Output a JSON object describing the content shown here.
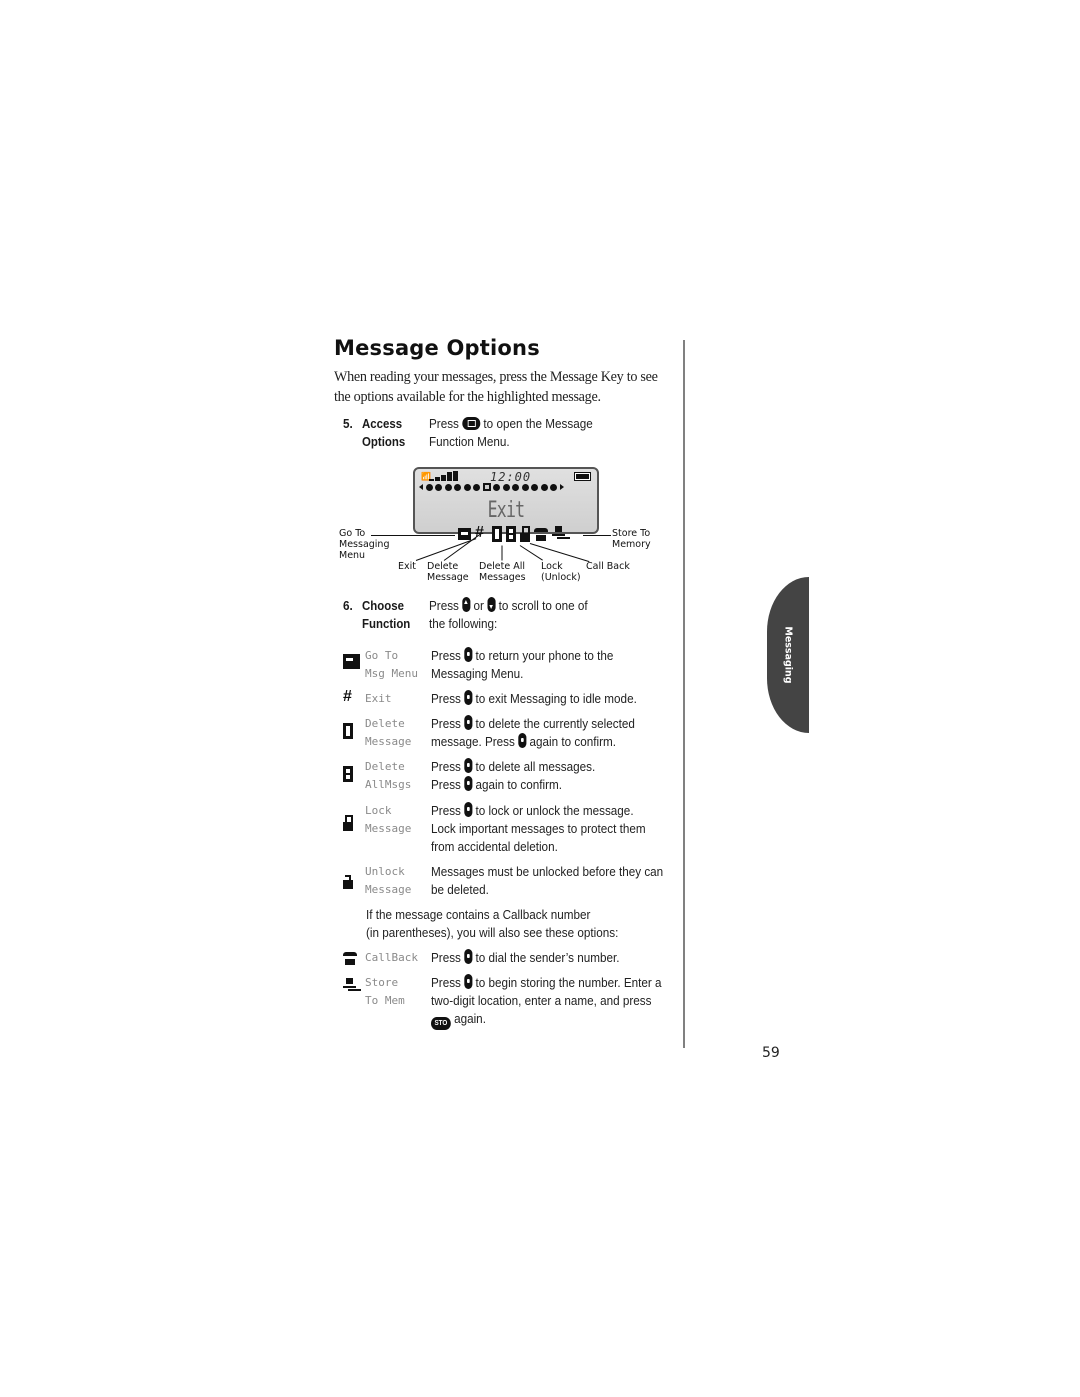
{
  "page": {
    "title": "Message Options",
    "intro": "When reading your messages, press the Message Key to see the options available for the highlighted message.",
    "page_number": "59",
    "section_tab": "Messaging"
  },
  "step5": {
    "number": "5.",
    "label_line1": "Access",
    "label_line2": "Options",
    "desc_pre": "Press",
    "desc_post": "to open the Message",
    "desc_line2": "Function Menu.",
    "key_icon": "message-key-icon"
  },
  "lcd": {
    "time": "12:00",
    "main_text": "Exit",
    "indicator_count": 14,
    "selected_indicator": 6
  },
  "callouts": {
    "goto": "Go To\nMessaging\nMenu",
    "store": "Store To\nMemory",
    "exit": "Exit",
    "delete": "Delete\nMessage",
    "delete_all": "Delete All\nMessages",
    "lock": "Lock\n(Unlock)",
    "callback": "Call Back"
  },
  "step6": {
    "number": "6.",
    "label_line1": "Choose",
    "label_line2": "Function",
    "desc_pre": "Press",
    "desc_or": "or",
    "desc_post": "to scroll to one of",
    "desc_line2": "the following:"
  },
  "functions": [
    {
      "icon": "go-to-messaging-icon",
      "name1": "Go To",
      "name2": "Msg Menu",
      "line1_pre": "Press",
      "line1_post": "to return your phone to the",
      "line2": "Messaging Menu.",
      "line3": ""
    },
    {
      "icon": "exit-icon",
      "name1": "Exit",
      "name2": "",
      "line1_pre": "Press",
      "line1_post": "to exit Messaging to idle mode.",
      "line2": "",
      "line3": ""
    },
    {
      "icon": "delete-message-icon",
      "name1": "Delete",
      "name2": "Message",
      "line1_pre": "Press",
      "line1_post": "to delete the currently selected",
      "line2_pre": "message. Press",
      "line2_post": "again to confirm."
    },
    {
      "icon": "delete-all-icon",
      "name1": "Delete",
      "name2": "AllMsgs",
      "line1_pre": "Press",
      "line1_post": "to delete all messages.",
      "line2_pre": "Press",
      "line2_post": "again to confirm."
    },
    {
      "icon": "lock-icon",
      "name1": "Lock",
      "name2": "Message",
      "line1_pre": "Press",
      "line1_post": "to lock or unlock the message.",
      "line2": "Lock important messages to protect them",
      "line3": "from accidental deletion."
    },
    {
      "icon": "unlock-icon",
      "name1": "Unlock",
      "name2": "Message",
      "line1": "Messages must be unlocked before they can",
      "line2": "be deleted."
    }
  ],
  "note": {
    "line1": "If the message contains a Callback number",
    "line2": "(in parentheses), you will also see these options:"
  },
  "callback_functions": [
    {
      "icon": "callback-icon",
      "name1": "CallBack",
      "line1_pre": "Press",
      "line1_post": "to dial the sender’s number."
    },
    {
      "icon": "store-to-memory-icon",
      "name1": "Store",
      "name2": "To Mem",
      "line1_pre": "Press",
      "line1_post": "to begin storing the number. Enter a",
      "line2": "two-digit location, enter a name, and press",
      "line3_key": "STO",
      "line3_post": "again."
    }
  ]
}
